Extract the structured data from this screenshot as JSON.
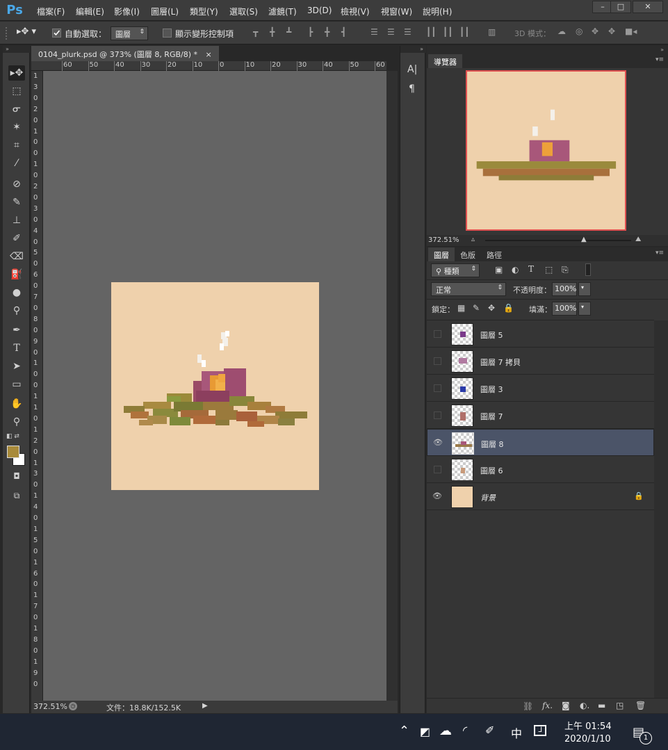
{
  "app": {
    "logo": "Ps"
  },
  "menu": [
    "檔案(F)",
    "編輯(E)",
    "影像(I)",
    "圖層(L)",
    "類型(Y)",
    "選取(S)",
    "濾鏡(T)",
    "3D(D)",
    "檢視(V)",
    "視窗(W)",
    "說明(H)"
  ],
  "window_buttons": [
    "–",
    "□",
    "✕"
  ],
  "options": {
    "auto_select_label": "自動選取：",
    "auto_select_value": "圖層",
    "show_transform_label": "顯示變形控制項",
    "mode3d_label": "3D 模式："
  },
  "document": {
    "tab_title": "0104_plurk.psd @ 373% (圖層 8, RGB/8) *",
    "close": "×",
    "ruler_h": [
      "60",
      "50",
      "40",
      "30",
      "20",
      "10",
      "0",
      "10",
      "20",
      "30",
      "40",
      "50",
      "60"
    ],
    "ruler_v": [
      "1",
      "3",
      "0",
      "2",
      "0",
      "1",
      "0",
      "0",
      "1",
      "0",
      "2",
      "0",
      "3",
      "0",
      "4",
      "0",
      "5",
      "0",
      "6",
      "0",
      "7",
      "0",
      "8",
      "0",
      "9",
      "0",
      "1",
      "0",
      "0",
      "1",
      "1",
      "0",
      "1",
      "2",
      "0",
      "1",
      "3",
      "0",
      "1",
      "4",
      "0",
      "1",
      "5",
      "0",
      "1",
      "6",
      "0",
      "1",
      "7",
      "0",
      "1",
      "8",
      "0",
      "1",
      "9",
      "0"
    ],
    "zoom": "372.51%",
    "file_info": "文件：18.8K/152.5K",
    "canvas_color": "#efd1ac"
  },
  "midpanel": {
    "char_icon": "A|",
    "para_icon": "¶"
  },
  "navigator": {
    "tab": "導覽器",
    "zoom": "372.51%",
    "frame_color": "#e05050"
  },
  "layers": {
    "tabs": [
      "圖層",
      "色版",
      "路徑"
    ],
    "filter_label": "種類",
    "blend_mode": "正常",
    "opacity_label": "不透明度：",
    "opacity_value": "100%",
    "lock_label": "鎖定：",
    "fill_label": "填滿：",
    "fill_value": "100%",
    "items": [
      {
        "name": "圖層 5",
        "visible": false,
        "selected": false
      },
      {
        "name": "圖層 7 拷貝",
        "visible": false,
        "selected": false
      },
      {
        "name": "圖層 3",
        "visible": false,
        "selected": false
      },
      {
        "name": "圖層 7",
        "visible": false,
        "selected": false
      },
      {
        "name": "圖層 8",
        "visible": true,
        "selected": true
      },
      {
        "name": "圖層 6",
        "visible": false,
        "selected": false
      },
      {
        "name": "背景",
        "visible": true,
        "selected": false
      }
    ]
  },
  "colors": {
    "foreground": "#a88a3a",
    "background": "#ffffff"
  },
  "taskbar": {
    "ime": "中",
    "time": "上午 01:54",
    "date": "2020/1/10",
    "notifications": "1"
  }
}
